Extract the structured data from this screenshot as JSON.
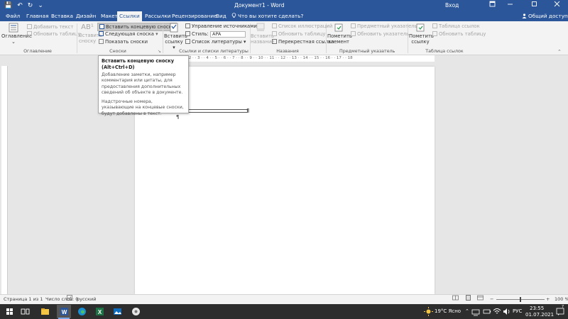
{
  "window": {
    "title": "Документ1 - Word",
    "sign_in": "Вход",
    "quick_access": {
      "save": "💾",
      "undo": "↶",
      "redo": "↻",
      "customize": "⌄"
    }
  },
  "tabs": [
    "Файл",
    "Главная",
    "Вставка",
    "Дизайн",
    "Макет",
    "Ссылки",
    "Рассылки",
    "Рецензирование",
    "Вид"
  ],
  "active_tab": "Ссылки",
  "tell_me": "Что вы хотите сделать?",
  "share": "Общий доступ",
  "ribbon": {
    "toc": {
      "big_label": "Оглавление",
      "add_text": "Добавить текст",
      "update_table": "Обновить таблицу",
      "group": "Оглавление"
    },
    "footnotes": {
      "big_label_1": "Вставить",
      "big_label_2": "сноску",
      "insert_endnote": "Вставить концевую сноску",
      "next_footnote": "Следующая сноска",
      "show_notes": "Показать сноски",
      "group": "Сноски",
      "ab_label": "AB¹"
    },
    "citations": {
      "big_label_1": "Вставить",
      "big_label_2": "ссылку",
      "manage_sources": "Управление источниками",
      "style_label": "Стиль:",
      "style_value": "APA",
      "bibliography": "Список литературы",
      "group": "Ссылки и списки литературы"
    },
    "captions": {
      "big_label_1": "Вставить",
      "big_label_2": "название",
      "table_of_figures": "Список иллюстраций",
      "update_table": "Обновить таблицу",
      "cross_reference": "Перекрестная ссылка",
      "group": "Названия"
    },
    "index": {
      "big_label_1": "Пометить",
      "big_label_2": "элемент",
      "insert_index": "Предметный указатель",
      "update_index": "Обновить указатель",
      "group": "Предметный указатель"
    },
    "toa": {
      "big_label_1": "Пометить",
      "big_label_2": "ссылку",
      "insert_toa": "Таблица ссылок",
      "update_table": "Обновить таблицу",
      "group": "Таблица ссылок"
    }
  },
  "tooltip": {
    "title": "Вставить концевую сноску (Alt+Ctrl+D)",
    "para1": "Добавление заметки, например комментария или цитаты, для предоставления дополнительных сведений об объекте в документе.",
    "para2": "Надстрочные номера, указывающие на концевые сноски, будут добавлены в текст."
  },
  "ruler_label": "· 1 · · 2 · · 3 · · 4 · · 5 · · 6 · · 7 · · 8 · · 9 · · 10 · · 11 · · 12 · · 13 · · 14 · · 15 · · 16 · · 17 · · 18",
  "document": {
    "para_mark": "¶"
  },
  "status": {
    "page": "Страница 1 из 1",
    "words": "Число слов: 0",
    "language": "русский",
    "zoom": "100 %"
  },
  "taskbar": {
    "weather": "19°C Ясно",
    "lang": "РУС",
    "time": "23:55",
    "date": "01.07.2021",
    "notification_count": "7"
  },
  "colors": {
    "word_blue": "#2b579a",
    "ribbon_bg": "#f3f3f3",
    "taskbar_bg": "#2d2d2d"
  }
}
